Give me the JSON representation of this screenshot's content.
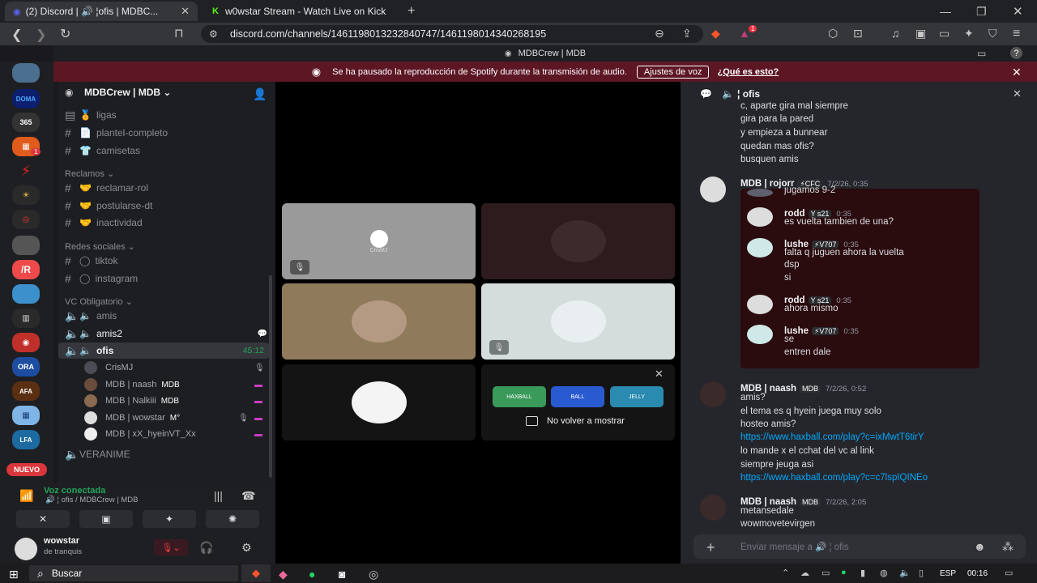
{
  "browser": {
    "tabs": [
      {
        "label": "(2) Discord | 🔊 ¦ofis | MDBC...",
        "active": true
      },
      {
        "label": "w0wstar Stream - Watch Live on Kick",
        "active": false
      }
    ],
    "url": "discord.com/channels/1461198013232840747/1461198014340268195",
    "icons": [
      "back-icon",
      "forward-icon",
      "reload-icon",
      "bookmark-icon",
      "zoom-icon",
      "share-icon",
      "brave-shield-icon",
      "rewards-icon",
      "extensions-icon",
      "music-icon",
      "sidebar-icon",
      "wallet-icon",
      "leo-icon",
      "vpn-icon",
      "menu-icon"
    ],
    "brave_badge": "1"
  },
  "discord_title": "MDBCrew | MDB",
  "notice": {
    "text": "Se ha pausado la reproducción de Spotify durante la transmisión de audio.",
    "button": "Ajustes de voz",
    "link": "¿Qué es esto?"
  },
  "guilds": {
    "new_label": "NUEVO",
    "badge": "1"
  },
  "server": {
    "name": "MDBCrew | MDB",
    "channels_top": [
      {
        "icon": "🏅",
        "name": "ligas"
      },
      {
        "icon": "📄",
        "name": "plantel-completo"
      },
      {
        "icon": "👕",
        "name": "camisetas"
      }
    ],
    "categories": {
      "reclamos": "Reclamos",
      "redes": "Redes sociales",
      "vc": "VC Obligatorio"
    },
    "reclamos": [
      "reclamar-rol",
      "postularse-dt",
      "inactividad"
    ],
    "redes": [
      "tiktok",
      "instagram"
    ],
    "voice": [
      {
        "name": "amis"
      },
      {
        "name": "amis2"
      },
      {
        "name": "ofis",
        "time": "45:12"
      }
    ],
    "voice_users": [
      {
        "name": "CrisMJ",
        "tag": ""
      },
      {
        "name": "MDB | naash",
        "tag": "MDB"
      },
      {
        "name": "MDB | Nalkiii",
        "tag": "MDB"
      },
      {
        "name": "MDB | wowstar",
        "tag": "M°"
      },
      {
        "name": "MDB | xX_hyeinVT_Xx",
        "tag": ""
      }
    ],
    "extra_channel": "VERANIME"
  },
  "voice_status": {
    "status": "Voz conectada",
    "location": "🔊 ¦ ofis / MDBCrew | MDB"
  },
  "user": {
    "name": "wowstar",
    "status": "de tranquis"
  },
  "stage": {
    "tile1_label": "CrisMJ",
    "popup_checkbox": "No volver a mostrar",
    "activities": [
      "HAXBALL",
      "BALL",
      "JELLY"
    ]
  },
  "chat": {
    "channel_name": "ofis",
    "lines_top": [
      "c, aparte gira mal siempre",
      "gira para la pared",
      "y empieza a bunnear",
      "quedan mas ofis?",
      "busquen amis"
    ],
    "msg1": {
      "author": "MDB | rojorr",
      "badge": "⚡CFC",
      "time": "7/2/26, 0:35"
    },
    "thread": [
      {
        "author": "",
        "badge": "",
        "time": "",
        "lines": [
          "jugamos 9-2"
        ]
      },
      {
        "author": "rodd",
        "badge": "Y s21",
        "time": "0:35",
        "lines": [
          "es vuelta tambien de una?"
        ]
      },
      {
        "author": "lushe",
        "badge": "⚡V707",
        "time": "0:35",
        "lines": [
          "falta q juguen ahora la vuelta",
          "dsp",
          "si"
        ]
      },
      {
        "author": "rodd",
        "badge": "Y s21",
        "time": "0:35",
        "lines": [
          "ahora mismo"
        ]
      },
      {
        "author": "lushe",
        "badge": "⚡V707",
        "time": "0:35",
        "lines": [
          "se",
          "entren dale"
        ]
      }
    ],
    "msg2": {
      "author": "MDB | naash",
      "badge": "MDB",
      "time": "7/2/26, 0:52",
      "lines": [
        "amis?",
        "el tema es q hyein juega muy solo",
        "hosteo amis?"
      ],
      "link1": "https://www.haxball.com/play?c=ixMwtT6tirY",
      "lines2": [
        "lo mande x el cchat del vc al link",
        "siempre jeuga asi"
      ],
      "link2": "https://www.haxball.com/play?c=c7lspIQINEo"
    },
    "msg3": {
      "author": "MDB | naash",
      "badge": "MDB",
      "time": "7/2/26, 2:05",
      "lines": [
        "metansedale",
        "wowmovetevirgen"
      ]
    },
    "placeholder": "Enviar mensaje a 🔊 ¦ ofis"
  },
  "taskbar": {
    "search": "Buscar",
    "lang": "ESP",
    "time": "00:16"
  }
}
